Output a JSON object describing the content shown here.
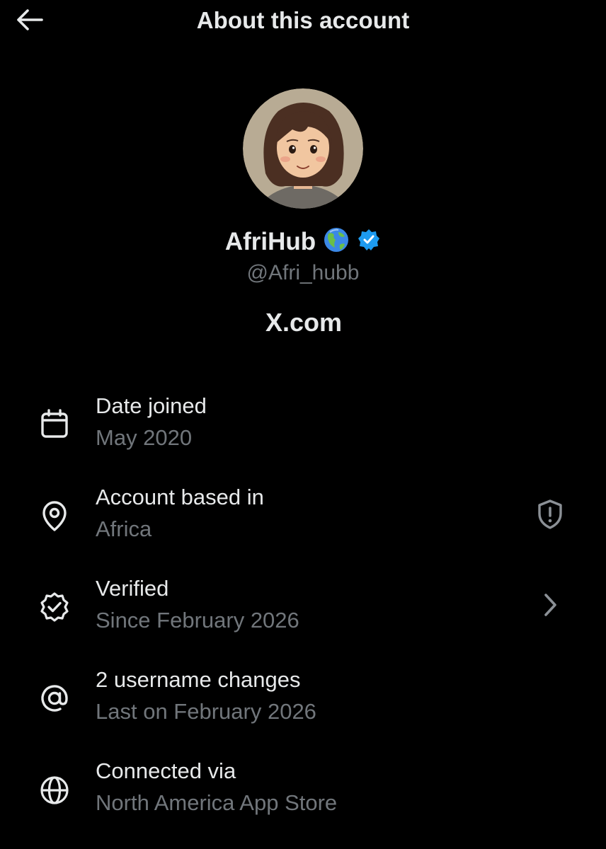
{
  "header": {
    "title": "About this account",
    "back_icon": "arrow-left-icon"
  },
  "profile": {
    "display_name": "AfriHub",
    "emoji": "🌎",
    "verified_badge_color": "#1d9bf0",
    "handle": "@Afri_hubb",
    "site": "X.com",
    "avatar": "illustrated-portrait"
  },
  "details": [
    {
      "icon": "calendar-icon",
      "title": "Date joined",
      "subtitle": "May 2020"
    },
    {
      "icon": "location-pin-icon",
      "title": "Account based in",
      "subtitle": "Africa",
      "right_icon": "shield-alert-icon"
    },
    {
      "icon": "verified-check-icon",
      "title": "Verified",
      "subtitle": "Since February 2026",
      "right_icon": "chevron-right-icon"
    },
    {
      "icon": "at-sign-icon",
      "title": "2 username changes",
      "subtitle": "Last on February 2026"
    },
    {
      "icon": "globe-icon",
      "title": "Connected via",
      "subtitle": "North America App Store"
    }
  ],
  "colors": {
    "background": "#000000",
    "primary_text": "#e7e9ea",
    "secondary_text": "#71767b",
    "accent": "#1d9bf0"
  }
}
